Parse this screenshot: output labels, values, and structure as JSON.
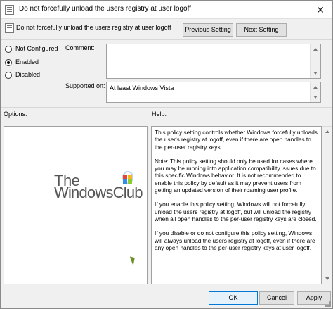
{
  "window": {
    "title": "Do not forcefully unload the users registry at user logoff",
    "close_glyph": "✕"
  },
  "header": {
    "title": "Do not forcefully unload the users registry at user logoff",
    "prev_label": "Previous Setting",
    "next_label": "Next Setting"
  },
  "state": {
    "options": [
      {
        "label": "Not Configured",
        "selected": false
      },
      {
        "label": "Enabled",
        "selected": true
      },
      {
        "label": "Disabled",
        "selected": false
      }
    ]
  },
  "labels": {
    "comment": "Comment:",
    "supported_on": "Supported on:",
    "options": "Options:",
    "help": "Help:"
  },
  "fields": {
    "comment_value": "",
    "supported_value": "At least Windows Vista"
  },
  "logo": {
    "line1": "The",
    "line2": "WindowsClub"
  },
  "help_text": [
    "This policy setting  controls whether Windows forcefully unloads the user's registry at logoff, even if there are open handles to the per-user registry keys.",
    "Note: This policy setting should only be used for cases where you may be running into application compatibility issues due to this specific Windows behavior. It is not recommended to enable this policy by default as it may prevent users from getting an updated version of their roaming user profile.",
    "If you enable this policy setting, Windows will not forcefully unload the users registry at logoff, but will unload the registry when all open handles to the per-user registry keys are closed.",
    "If you disable or do not configure this policy setting, Windows will always unload the users registry at logoff, even if there are any open handles to the per-user registry keys at user logoff."
  ],
  "footer": {
    "ok_label": "OK",
    "cancel_label": "Cancel",
    "apply_label": "Apply"
  },
  "colors": {
    "window_bg": "#f0f0f0",
    "accent": "#0078d7"
  },
  "icons": [
    "policy-doc-icon",
    "close-icon",
    "scroll-up-icon",
    "scroll-down-icon",
    "windows-logo-icon",
    "mouse-cursor-icon"
  ]
}
